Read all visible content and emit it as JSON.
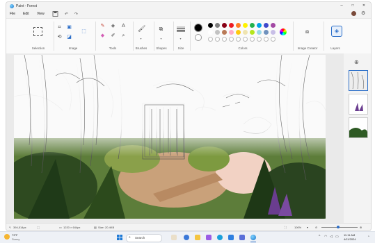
{
  "window": {
    "title": "Paint - Forest",
    "controls": {
      "minimize": "–",
      "maximize": "□",
      "close": "✕"
    }
  },
  "menu": {
    "file": "File",
    "edit": "Edit",
    "view": "View",
    "save_icon": "save-icon",
    "undo_icon": "undo-icon",
    "redo_icon": "redo-icon"
  },
  "ribbon": {
    "groups": {
      "selection": "Selection",
      "image": "Image",
      "tools": "Tools",
      "brushes": "Brushes",
      "shapes": "Shapes",
      "size": "Size",
      "colors": "Colors",
      "image_creator": "Image Creator",
      "layers": "Layers"
    },
    "colors": {
      "primary": "#000000",
      "secondary": "#ffffff",
      "row1": [
        "#000000",
        "#7f7f7f",
        "#880015",
        "#ed1c24",
        "#ff7f27",
        "#fff200",
        "#22b14c",
        "#00a2e8",
        "#3f48cc",
        "#a349a4"
      ],
      "row2": [
        "#ffffff",
        "#c3c3c3",
        "#b97a57",
        "#ffaec9",
        "#ffc90e",
        "#efe4b0",
        "#b5e61d",
        "#99d9ea",
        "#7092be",
        "#c8bfe7"
      ]
    }
  },
  "status": {
    "cursor": "394,514px",
    "canvas_size": "1220 × 644px",
    "file_size": "Size: 20.4KB",
    "zoom": "100%"
  },
  "taskbar": {
    "weather_temp": "73°F",
    "weather_text": "Sunny",
    "search_placeholder": "Search",
    "time": "11:11 AM",
    "date": "4/11/2024"
  }
}
